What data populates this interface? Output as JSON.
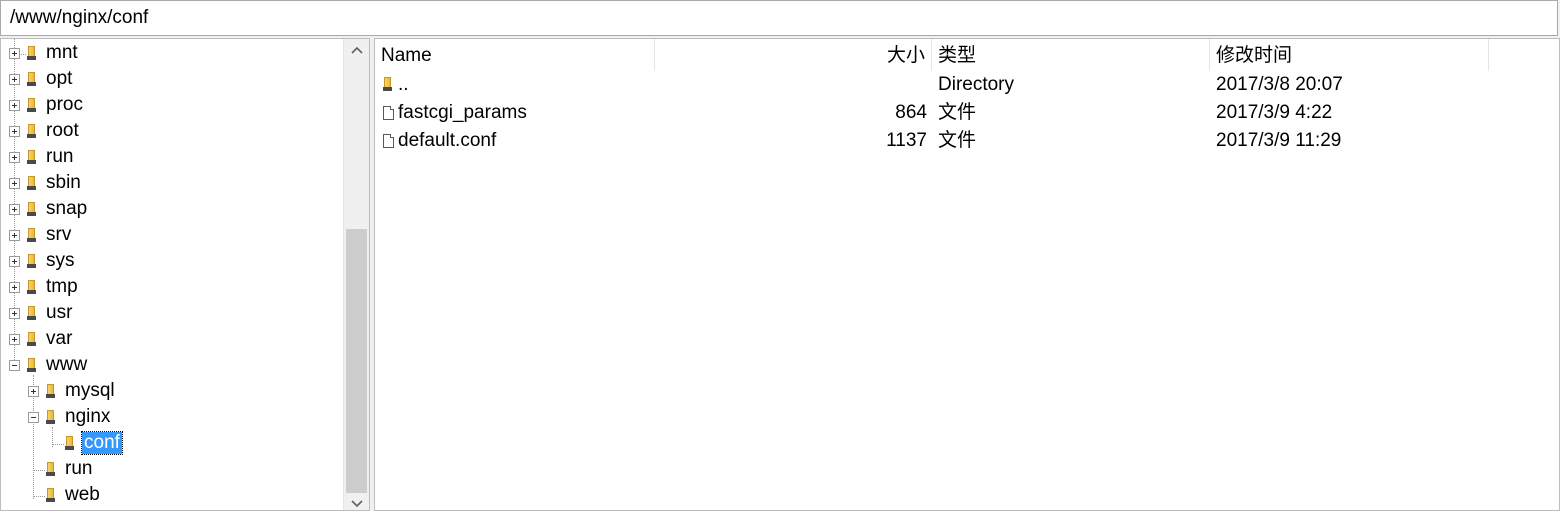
{
  "path_bar": {
    "value": "/www/nginx/conf"
  },
  "tree": {
    "items": [
      {
        "label": "mnt",
        "expander": "plus"
      },
      {
        "label": "opt",
        "expander": "plus"
      },
      {
        "label": "proc",
        "expander": "plus"
      },
      {
        "label": "root",
        "expander": "plus"
      },
      {
        "label": "run",
        "expander": "plus"
      },
      {
        "label": "sbin",
        "expander": "plus"
      },
      {
        "label": "snap",
        "expander": "plus"
      },
      {
        "label": "srv",
        "expander": "plus"
      },
      {
        "label": "sys",
        "expander": "plus"
      },
      {
        "label": "tmp",
        "expander": "plus"
      },
      {
        "label": "usr",
        "expander": "plus"
      },
      {
        "label": "var",
        "expander": "plus"
      },
      {
        "label": "www",
        "expander": "minus"
      },
      {
        "label": "mysql",
        "expander": "plus"
      },
      {
        "label": "nginx",
        "expander": "minus"
      },
      {
        "label": "conf",
        "expander": "none",
        "selected": true
      },
      {
        "label": "run",
        "expander": "none"
      },
      {
        "label": "web",
        "expander": "none"
      }
    ]
  },
  "list": {
    "columns": {
      "name": "Name",
      "size": "大小",
      "type": "类型",
      "modified": "修改时间"
    },
    "rows": [
      {
        "icon": "folder-icon",
        "name": "..",
        "size": "",
        "type": "Directory",
        "modified": "2017/3/8 20:07"
      },
      {
        "icon": "file-icon",
        "name": "fastcgi_params",
        "size": "864",
        "type": "文件",
        "modified": "2017/3/9 4:22"
      },
      {
        "icon": "file-icon",
        "name": "default.conf",
        "size": "1137",
        "type": "文件",
        "modified": "2017/3/9 11:29"
      }
    ]
  },
  "colors": {
    "selection": "#3399ff",
    "folder": "#e9b83a"
  }
}
